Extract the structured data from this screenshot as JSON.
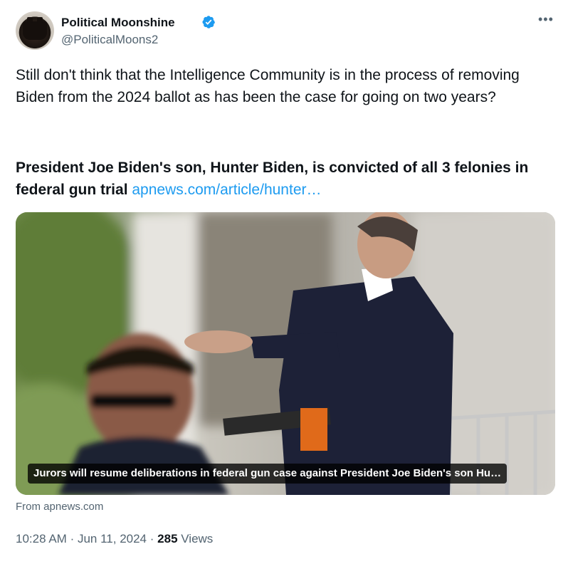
{
  "author": {
    "display_name": "Political Moonshine",
    "handle": "@PoliticalMoons2",
    "verified": true,
    "avatar_icon": "avatar-image"
  },
  "more_icon": "ellipsis-icon",
  "tweet": {
    "text": "Still don't think that the Intelligence Community is in the process of removing Biden from the 2024 ballot as has been the case for going on two years?",
    "headline": "President Joe Biden's son, Hunter Biden, is convicted of all 3 felonies in federal gun trial",
    "link_text": "apnews.com/article/hunter…"
  },
  "card": {
    "caption": "Jurors will resume deliberations in federal gun case against President Joe Biden's son Hu…",
    "source": "From apnews.com"
  },
  "meta": {
    "time": "10:28 AM",
    "date": "Jun 11, 2024",
    "separator": "·",
    "views_count": "285",
    "views_label": "Views"
  },
  "colors": {
    "link": "#1d9bf0",
    "verified": "#1d9bf0",
    "secondary_text": "#536471",
    "primary_text": "#0f1419"
  }
}
